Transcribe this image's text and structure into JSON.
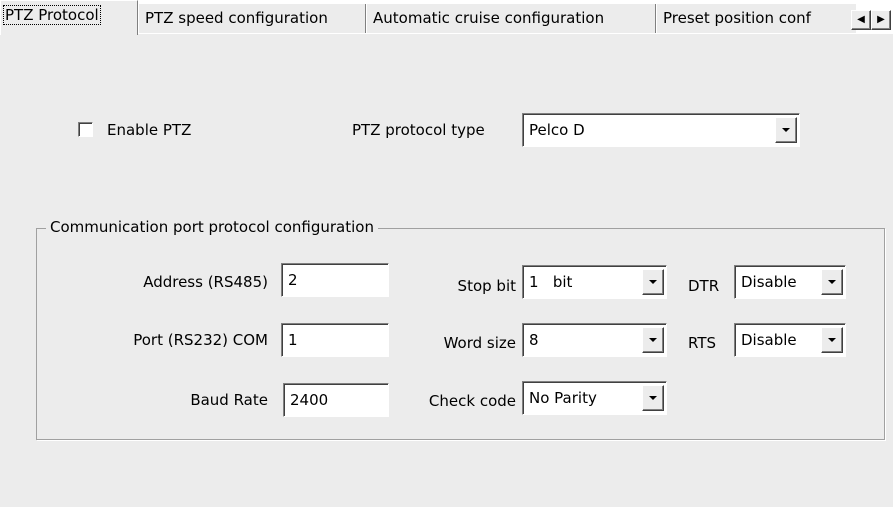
{
  "tabs": [
    {
      "label": "PTZ Protocol",
      "active": true
    },
    {
      "label": "PTZ speed configuration",
      "active": false
    },
    {
      "label": "Automatic cruise configuration",
      "active": false
    },
    {
      "label": "Preset position conf",
      "active": false
    }
  ],
  "tab_scroll": {
    "left_icon": "arrow-left-icon",
    "right_icon": "arrow-right-icon"
  },
  "enable_ptz": {
    "label": "Enable PTZ",
    "checked": false
  },
  "protocol_type": {
    "label": "PTZ protocol type",
    "value": "Pelco D"
  },
  "comm_group": {
    "title": "Communication port protocol configuration",
    "address": {
      "label": "Address (RS485)",
      "value": "2"
    },
    "port": {
      "label": "Port (RS232)  COM",
      "value": "1"
    },
    "baud": {
      "label": "Baud Rate",
      "value": "2400"
    },
    "stop_bit": {
      "label": "Stop bit",
      "value": "1   bit"
    },
    "word_size": {
      "label": "Word size",
      "value": "8"
    },
    "check_code": {
      "label": "Check code",
      "value": "No Parity"
    },
    "dtr": {
      "label": "DTR",
      "value": "Disable"
    },
    "rts": {
      "label": "RTS",
      "value": "Disable"
    }
  },
  "colors": {
    "panel": "#ececec",
    "field": "#ffffff"
  }
}
